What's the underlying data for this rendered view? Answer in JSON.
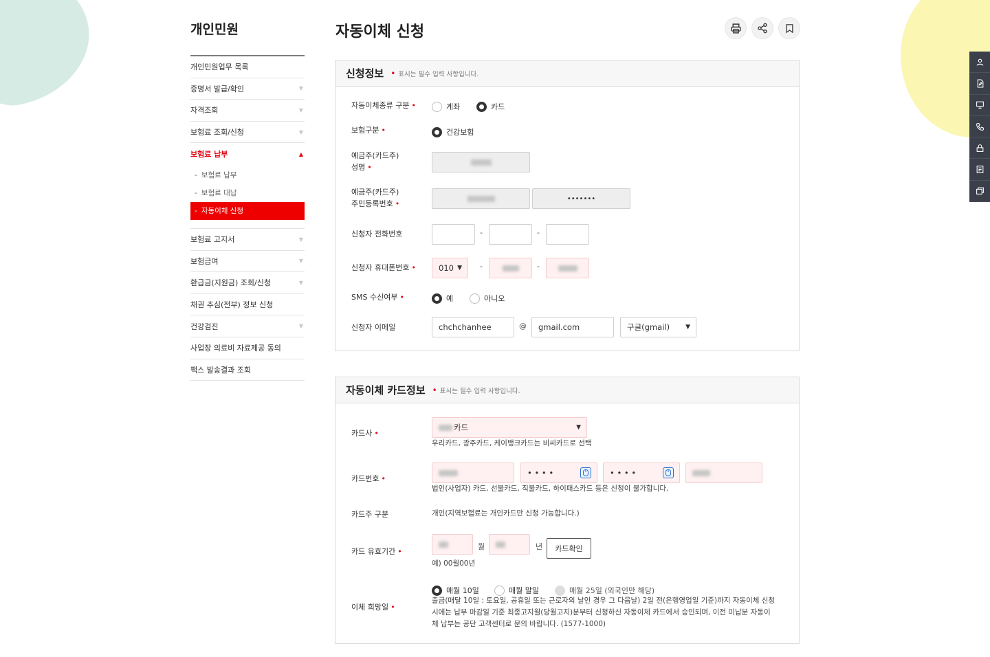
{
  "sidebar": {
    "title": "개인민원",
    "items": [
      {
        "label": "개인민원업무 목록",
        "arrow": false
      },
      {
        "label": "증명서 발급/확인",
        "arrow": true
      },
      {
        "label": "자격조회",
        "arrow": true
      },
      {
        "label": "보험료 조회/신청",
        "arrow": true
      },
      {
        "label": "보험료 납부",
        "arrow": true,
        "active": true
      },
      {
        "label": "보험료 고지서",
        "arrow": true
      },
      {
        "label": "보험급여",
        "arrow": true
      },
      {
        "label": "환급금(지원금) 조회/신청",
        "arrow": true
      },
      {
        "label": "채권 추심(전부) 정보 신청",
        "arrow": false
      },
      {
        "label": "건강검진",
        "arrow": true
      },
      {
        "label": "사업장 의료비 자료제공 동의",
        "arrow": false
      },
      {
        "label": "팩스 발송결과 조회",
        "arrow": false
      }
    ],
    "sub_items": [
      "보험료 납부",
      "보험료 대납",
      "자동이체 신청"
    ]
  },
  "header": {
    "title": "자동이체 신청",
    "tools": [
      "print-icon",
      "share-icon",
      "bookmark-icon"
    ]
  },
  "section1": {
    "title": "신청정보",
    "req_note": "표시는 필수 입력 사항입니다.",
    "type_label": "자동이체종류 구분",
    "type_options": [
      "계좌",
      "카드"
    ],
    "type_selected": "카드",
    "ins_label": "보험구분",
    "ins_option": "건강보험",
    "owner_name_label_1": "예금주(카드주)",
    "owner_name_label_2": "성명",
    "owner_rrn_label_1": "예금주(카드주)",
    "owner_rrn_label_2": "주민등록번호",
    "owner_rrn_masked": "•••••••",
    "phone_label": "신청자 전화번호",
    "mobile_label": "신청자 휴대폰번호",
    "mobile_prefix": "010",
    "sms_label": "SMS 수신여부",
    "sms_options": [
      "예",
      "아니오"
    ],
    "sms_selected": "예",
    "email_label": "신청자 이메일",
    "email_id": "chchchanhee",
    "email_at": "@",
    "email_domain": "gmail.com",
    "email_select": "구글(gmail)",
    "dash": "-"
  },
  "section2": {
    "title": "자동이체 카드정보",
    "req_note": "표시는 필수 입력 사항입니다.",
    "company_label": "카드사",
    "company_value": "카드",
    "company_help": "우리카드, 광주카드, 케이뱅크카드는 비씨카드로 선택",
    "number_label": "카드번호",
    "number_mask": "• • • •",
    "number_help": "법인(사업자) 카드, 선불카드, 직불카드, 하이패스카드 등은 신청이 불가합니다.",
    "holder_label": "카드주 구분",
    "holder_value": "개인(지역보험료는 개인카드만 신청 가능합니다.)",
    "expiry_label": "카드 유효기간",
    "month_unit": "월",
    "year_unit": "년",
    "confirm_button": "카드확인",
    "expiry_help": "예) 00월00년",
    "date_label": "이체 희망일",
    "date_options": [
      "매월 10일",
      "매월 말일",
      "매월 25일 (외국인만 해당)"
    ],
    "date_selected": "매월 10일",
    "date_help": "출금(매달 10일 : 토요일, 공휴일 또는 근로자의 날인 경우 그 다음날) 2일 전(은행영업일 기준)까지 자동이체 신청시에는 납부 마감일 기준 최종고지월(당월고지)분부터 신청하신 자동이체 카드에서 승인되며, 이전 미납분 자동이체 납부는 공단 고객센터로 문의 바랍니다. (1577-1000)"
  },
  "quick_menu": [
    "user-icon",
    "document-edit-icon",
    "monitor-icon",
    "phone-icon",
    "lock-icon",
    "list-icon",
    "cards-icon"
  ],
  "colors": {
    "accent": "#e30613",
    "active_bg": "#ee0000",
    "quick_bg": "#3b3f4a"
  }
}
